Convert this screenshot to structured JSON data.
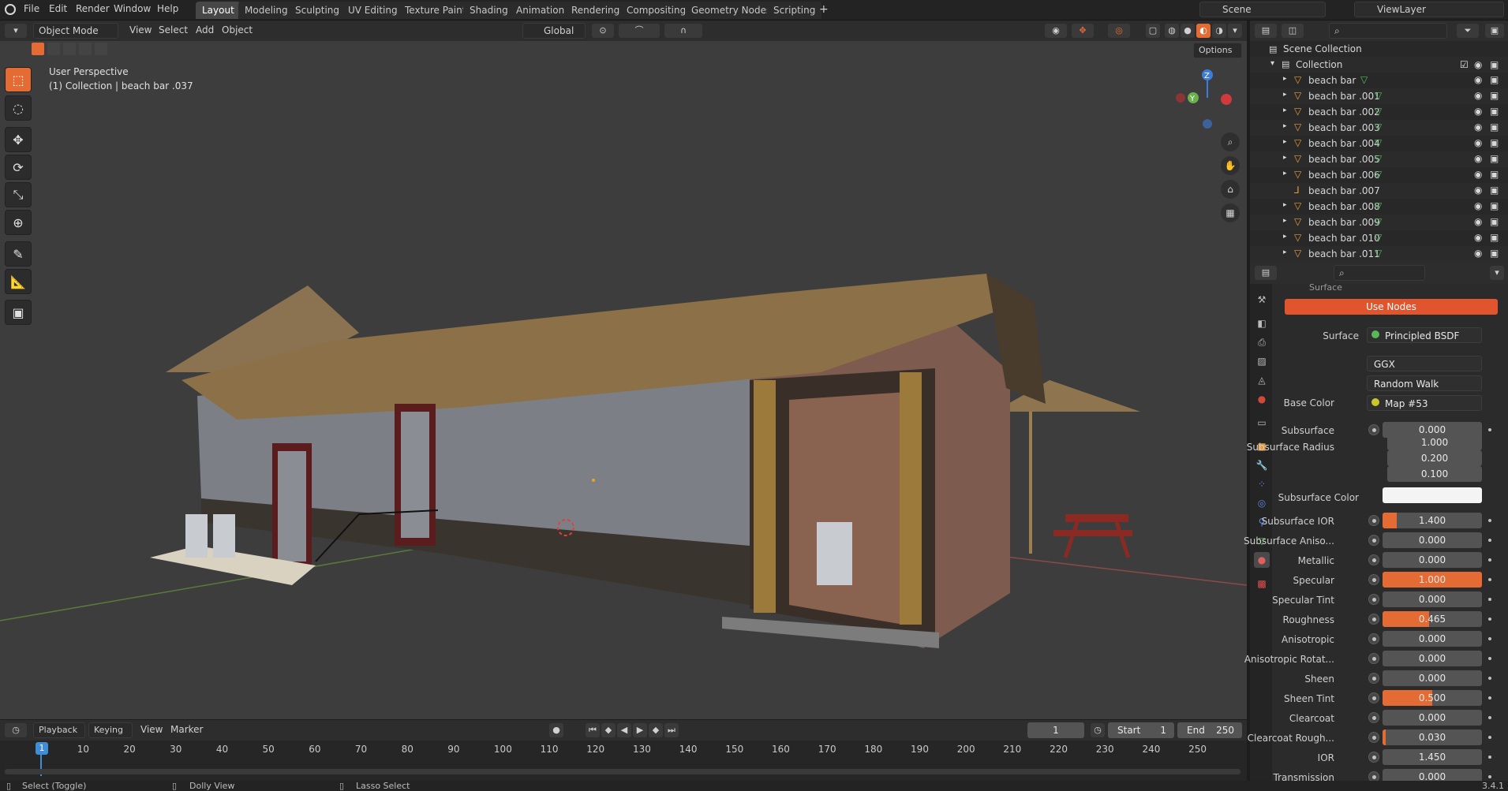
{
  "topbar": {
    "menus": [
      "File",
      "Edit",
      "Render",
      "Window",
      "Help"
    ],
    "workspaces": [
      "Layout",
      "Modeling",
      "Sculpting",
      "UV Editing",
      "Texture Paint",
      "Shading",
      "Animation",
      "Rendering",
      "Compositing",
      "Geometry Nodes",
      "Scripting"
    ],
    "active_workspace": "Layout",
    "scene": "Scene",
    "view_layer": "ViewLayer"
  },
  "viewport_header": {
    "mode": "Object Mode",
    "menus": [
      "View",
      "Select",
      "Add",
      "Object"
    ],
    "orientation": "Global",
    "options_label": "Options"
  },
  "viewport": {
    "perspective_label": "User Perspective",
    "collection_label": "(1) Collection | beach bar .037",
    "gizmo_axes": [
      "Z",
      "Y"
    ]
  },
  "outliner": {
    "scene_collection": "Scene Collection",
    "collection": "Collection",
    "items": [
      "beach bar",
      "beach bar .001",
      "beach bar .002",
      "beach bar .003",
      "beach bar .004",
      "beach bar .005",
      "beach bar .006",
      "beach bar .007",
      "beach bar .008",
      "beach bar .009",
      "beach bar .010",
      "beach bar .011"
    ]
  },
  "properties": {
    "section_partial": "Surface",
    "use_nodes": "Use Nodes",
    "surface_label": "Surface",
    "surface_value": "Principled BSDF",
    "distribution": "GGX",
    "subsurface_method": "Random Walk",
    "base_color_label": "Base Color",
    "base_color_value": "Map #53",
    "rows": [
      {
        "label": "Subsurface",
        "value": "0.000",
        "fill": 0
      },
      {
        "label": "Subsurface IOR",
        "value": "1.400",
        "fill": 0.14
      },
      {
        "label": "Subsurface Aniso...",
        "value": "0.000",
        "fill": 0
      },
      {
        "label": "Metallic",
        "value": "0.000",
        "fill": 0
      },
      {
        "label": "Specular",
        "value": "1.000",
        "fill": 1
      },
      {
        "label": "Specular Tint",
        "value": "0.000",
        "fill": 0
      },
      {
        "label": "Roughness",
        "value": "0.465",
        "fill": 0.465
      },
      {
        "label": "Anisotropic",
        "value": "0.000",
        "fill": 0
      },
      {
        "label": "Anisotropic Rotat...",
        "value": "0.000",
        "fill": 0
      },
      {
        "label": "Sheen",
        "value": "0.000",
        "fill": 0
      },
      {
        "label": "Sheen Tint",
        "value": "0.500",
        "fill": 0.5
      },
      {
        "label": "Clearcoat",
        "value": "0.000",
        "fill": 0
      },
      {
        "label": "Clearcoat Rough...",
        "value": "0.030",
        "fill": 0.03
      },
      {
        "label": "IOR",
        "value": "1.450",
        "fill": 0
      },
      {
        "label": "Transmission",
        "value": "0.000",
        "fill": 0
      }
    ],
    "subsurface_radius_label": "Subsurface Radius",
    "subsurface_radius": [
      "1.000",
      "0.200",
      "0.100"
    ],
    "subsurface_color_label": "Subsurface Color",
    "accent_color": "#e46b33"
  },
  "timeline": {
    "menus": [
      "Playback",
      "Keying",
      "View",
      "Marker"
    ],
    "current_frame": "1",
    "start_label": "Start",
    "start": "1",
    "end_label": "End",
    "end": "250",
    "ticks": [
      "1",
      "10",
      "20",
      "30",
      "40",
      "50",
      "60",
      "70",
      "80",
      "90",
      "100",
      "110",
      "120",
      "130",
      "140",
      "150",
      "160",
      "170",
      "180",
      "190",
      "200",
      "210",
      "220",
      "230",
      "240",
      "250"
    ]
  },
  "statusbar": {
    "select": "Select (Toggle)",
    "dolly": "Dolly View",
    "lasso": "Lasso Select",
    "version": "3.4.1"
  }
}
